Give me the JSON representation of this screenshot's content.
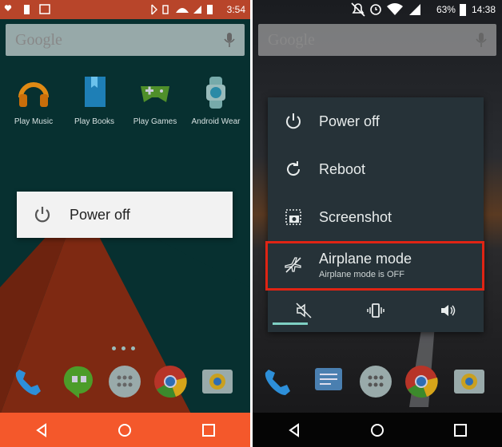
{
  "left": {
    "status": {
      "time": "3:54"
    },
    "search": {
      "logo": "Google"
    },
    "apps": [
      {
        "label": "Play Music",
        "icon": "headphones-icon"
      },
      {
        "label": "Play Books",
        "icon": "book-icon"
      },
      {
        "label": "Play Games",
        "icon": "gamepad-icon"
      },
      {
        "label": "Android Wear",
        "icon": "watch-icon"
      }
    ],
    "dialog": {
      "label": "Power off"
    },
    "colors": {
      "statusbar": "#b8452a",
      "navbar": "#f4582b"
    }
  },
  "right": {
    "status": {
      "battery": "63%",
      "time": "14:38"
    },
    "search": {
      "logo": "Google"
    },
    "menu": {
      "items": [
        {
          "label": "Power off",
          "icon": "power-icon"
        },
        {
          "label": "Reboot",
          "icon": "refresh-icon"
        },
        {
          "label": "Screenshot",
          "icon": "screenshot-icon"
        },
        {
          "label": "Airplane mode",
          "sub": "Airplane mode is OFF",
          "icon": "airplane-icon"
        }
      ],
      "sound_modes": [
        "mute-icon",
        "vibrate-icon",
        "volume-icon"
      ]
    },
    "colors": {
      "menu_bg": "#263238",
      "highlight": "#e02414",
      "active": "#7fd0c4"
    }
  }
}
